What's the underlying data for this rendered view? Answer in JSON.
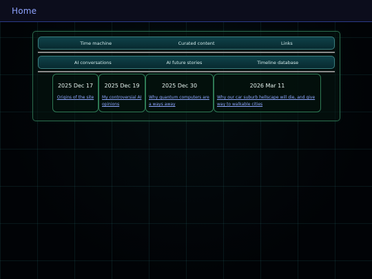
{
  "header": {
    "home_label": "Home"
  },
  "nav": {
    "row1": [
      "Time machine",
      "Curated content",
      "Links"
    ],
    "row2": [
      "AI conversations",
      "AI future stories",
      "Timeline database"
    ]
  },
  "cards": [
    {
      "date": "2025 Dec 17",
      "title": "Origins of the site"
    },
    {
      "date": "2025 Dec 19",
      "title": "My controversial AI opinions"
    },
    {
      "date": "2025 Dec 30",
      "title": "Why quantum computers are a ways away"
    },
    {
      "date": "2026 Mar 11",
      "title": "Why our car suburb hellscape will die, and give way to walkable cities"
    }
  ],
  "colors": {
    "accent_link": "#8fa3ff",
    "panel_border": "#2a6a4c",
    "nav_bg": "#0f4249",
    "header_bg": "#0c0d1c"
  }
}
